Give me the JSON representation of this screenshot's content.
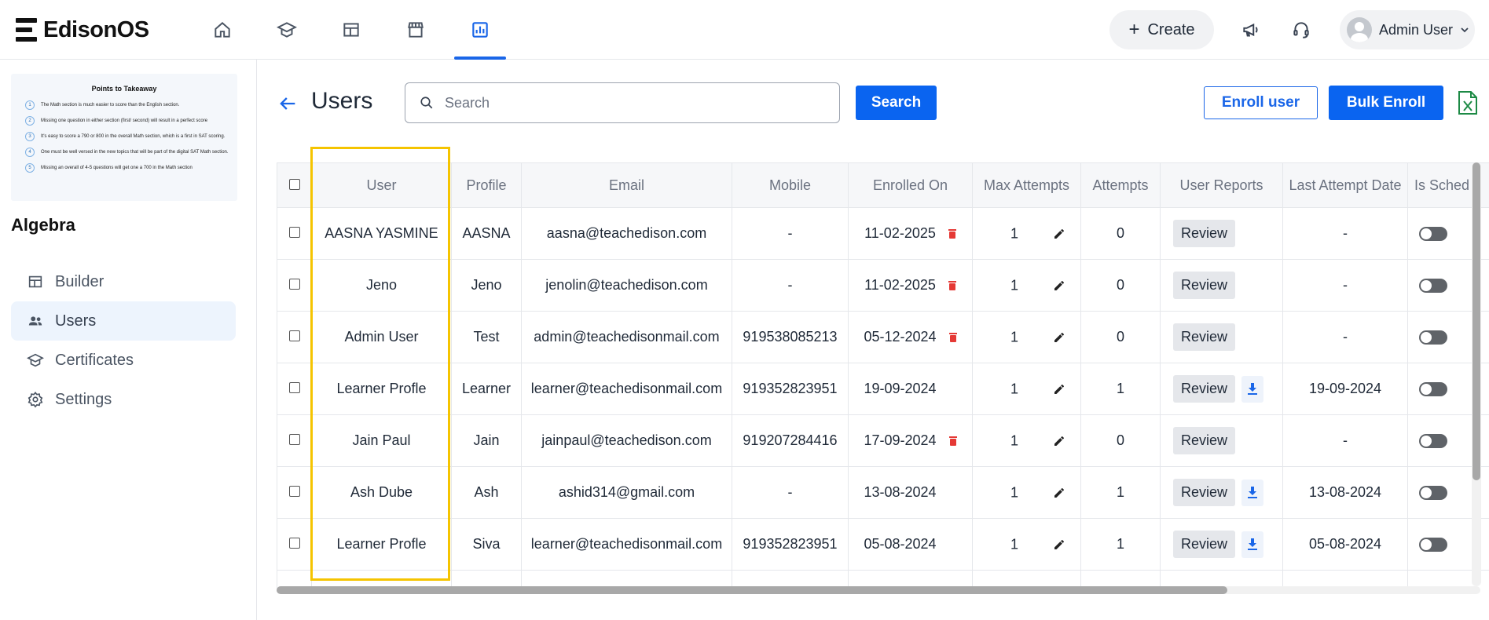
{
  "app": {
    "name": "EdisonOS"
  },
  "topnav": {
    "items": [
      {
        "name": "home-icon"
      },
      {
        "name": "courses-icon"
      },
      {
        "name": "dashboard-icon"
      },
      {
        "name": "store-icon"
      },
      {
        "name": "reports-icon",
        "active": true
      }
    ],
    "create_label": "Create",
    "user_name": "Admin User"
  },
  "sidebar": {
    "thumbnail": {
      "title": "Points to Takeaway",
      "points": [
        {
          "num": "1",
          "text": "The Math section is much easier to score than the English section."
        },
        {
          "num": "2",
          "text": "Missing one question in either section (first/ second) will result in a perfect score"
        },
        {
          "num": "3",
          "text": "It's easy to score a 790 or 800 in the overall Math section, which is a first in SAT scoring."
        },
        {
          "num": "4",
          "text": "One must be well versed in the new topics that will be part of the digital SAT Math section."
        },
        {
          "num": "5",
          "text": "Missing an overall of 4-5 questions will get one a 700 in the Math section"
        }
      ]
    },
    "course_title": "Algebra",
    "items": [
      {
        "label": "Builder",
        "icon": "builder-icon"
      },
      {
        "label": "Users",
        "icon": "users-icon",
        "active": true
      },
      {
        "label": "Certificates",
        "icon": "certificate-icon"
      },
      {
        "label": "Settings",
        "icon": "gear-icon"
      }
    ]
  },
  "page": {
    "title": "Users",
    "search_placeholder": "Search",
    "search_button": "Search",
    "enroll_button": "Enroll user",
    "bulk_enroll_button": "Bulk Enroll"
  },
  "table": {
    "headers": [
      "User",
      "Profile",
      "Email",
      "Mobile",
      "Enrolled On",
      "Max Attempts",
      "Attempts",
      "User Reports",
      "Last Attempt Date",
      "Is Sched"
    ],
    "review_label": "Review",
    "rows": [
      {
        "user": "AASNA YASMINE",
        "profile": "AASNA",
        "email": "aasna@teachedison.com",
        "mobile": "-",
        "enrolled": "11-02-2025",
        "deletable": true,
        "max_attempts": "1",
        "attempts": "0",
        "download": false,
        "last_attempt": "-"
      },
      {
        "user": "Jeno",
        "profile": "Jeno",
        "email": "jenolin@teachedison.com",
        "mobile": "-",
        "enrolled": "11-02-2025",
        "deletable": true,
        "max_attempts": "1",
        "attempts": "0",
        "download": false,
        "last_attempt": "-"
      },
      {
        "user": "Admin User",
        "profile": "Test",
        "email": "admin@teachedisonmail.com",
        "mobile": "919538085213",
        "enrolled": "05-12-2024",
        "deletable": true,
        "max_attempts": "1",
        "attempts": "0",
        "download": false,
        "last_attempt": "-"
      },
      {
        "user": "Learner Profle",
        "profile": "Learner",
        "email": "learner@teachedisonmail.com",
        "mobile": "919352823951",
        "enrolled": "19-09-2024",
        "deletable": false,
        "max_attempts": "1",
        "attempts": "1",
        "download": true,
        "last_attempt": "19-09-2024"
      },
      {
        "user": "Jain Paul",
        "profile": "Jain",
        "email": "jainpaul@teachedison.com",
        "mobile": "919207284416",
        "enrolled": "17-09-2024",
        "deletable": true,
        "max_attempts": "1",
        "attempts": "0",
        "download": false,
        "last_attempt": "-"
      },
      {
        "user": "Ash Dube",
        "profile": "Ash",
        "email": "ashid314@gmail.com",
        "mobile": "-",
        "enrolled": "13-08-2024",
        "deletable": false,
        "max_attempts": "1",
        "attempts": "1",
        "download": true,
        "last_attempt": "13-08-2024"
      },
      {
        "user": "Learner Profle",
        "profile": "Siva",
        "email": "learner@teachedisonmail.com",
        "mobile": "919352823951",
        "enrolled": "05-08-2024",
        "deletable": false,
        "max_attempts": "1",
        "attempts": "1",
        "download": true,
        "last_attempt": "05-08-2024"
      }
    ]
  },
  "colors": {
    "primary": "#0a64f0",
    "delete": "#e53935",
    "highlight": "#f5c400",
    "excel": "#1d8a45"
  }
}
